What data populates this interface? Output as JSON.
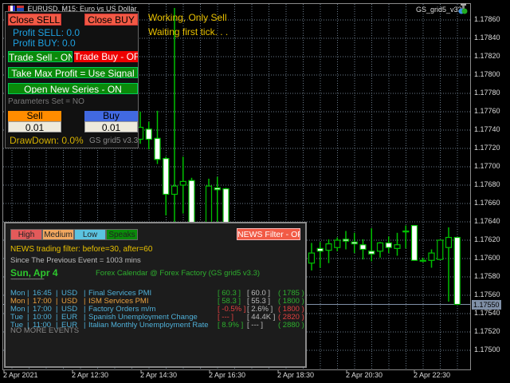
{
  "window": {
    "symbol_title": "EURUSD, M15:  Euro vs US Dollar",
    "ea_label": "GS_grid5_v33"
  },
  "status": {
    "line1": "Working, Only Sell",
    "line2": "Waiting first tick. . ."
  },
  "panel": {
    "close_sell": "Close  SELL",
    "close_buy": "Close  BUY",
    "profit_sell": "Profit SELL: 0.0",
    "profit_buy": "Profit BUY: 0.0",
    "trade_sell": "Trade Sell - ON",
    "trade_buy": "Trade Buy - OFF",
    "take_max_profit": "Take Max Profit = Use Signal",
    "open_new_series": "Open New Series - ON",
    "parameters_set": "Parameters Set = NO",
    "sell_label": "Sell",
    "buy_label": "Buy",
    "sell_lot": "0.01",
    "buy_lot": "0.01",
    "drawdown": "DrawDown: 0.0%",
    "version": "GS grid5 v3.3"
  },
  "news": {
    "impact_buttons": [
      {
        "label": "High",
        "color": "#e35a5a"
      },
      {
        "label": "Medium",
        "color": "#f2a860"
      },
      {
        "label": "Low",
        "color": "#5bc3e0"
      },
      {
        "label": "Speaks",
        "color": "#0a8a0a"
      }
    ],
    "filter_button": "NEWS Filter - OFF",
    "filter_text": "NEWS trading filter: before=30, after=60",
    "since_text": "Since The Previous Event = 1003 mins",
    "date": "Sun, Apr 4",
    "underline": "-------------------------",
    "source": "Forex Calendar @ Forex Factory     (GS grid5 v3.3)",
    "events": [
      {
        "day": "Mon",
        "time": "16:45",
        "cur": "USD",
        "title": "Final Services PMI",
        "actual": "[ 60.3 ]",
        "forecast": "[ 60.0 ]",
        "mins": "( 1785 )",
        "color": "#4fb0d8",
        "actual_color": "#2eae2e",
        "mins_color": "#2eae2e"
      },
      {
        "day": "Mon",
        "time": "17:00",
        "cur": "USD",
        "title": "ISM Services PMI",
        "actual": "[ 58.3 ]",
        "forecast": "[ 55.3 ]",
        "mins": "( 1800 )",
        "color": "#e8a040",
        "actual_color": "#2eae2e",
        "mins_color": "#2eae2e"
      },
      {
        "day": "Mon",
        "time": "17:00",
        "cur": "USD",
        "title": "Factory Orders m/m",
        "actual": "[ -0.5% ]",
        "forecast": "[ 2.6% ]",
        "mins": "( 1800 )",
        "color": "#4fb0d8",
        "actual_color": "#e04040",
        "mins_color": "#e04040"
      },
      {
        "day": "Tue",
        "time": "10:00",
        "cur": "EUR",
        "title": "Spanish Unemployment Change",
        "actual": "[ --- ]",
        "forecast": "[ 44.4K ]",
        "mins": "( 2820 )",
        "color": "#4fb0d8",
        "actual_color": "#e04040",
        "mins_color": "#e04040"
      },
      {
        "day": "Tue",
        "time": "11:00",
        "cur": "EUR",
        "title": "Italian Monthly Unemployment Rate",
        "actual": "[ 8.9% ]",
        "forecast": "[ --- ]",
        "mins": "( 2880 )",
        "color": "#4fb0d8",
        "actual_color": "#2eae2e",
        "mins_color": "#2eae2e"
      }
    ],
    "no_more": "NO MORE EVENTS"
  },
  "chart_data": {
    "type": "candlestick",
    "price_axis": [
      "1.17860",
      "1.17840",
      "1.17820",
      "1.17800",
      "1.17780",
      "1.17760",
      "1.17740",
      "1.17720",
      "1.17700",
      "1.17680",
      "1.17660",
      "1.17640",
      "1.17620",
      "1.17600",
      "1.17580",
      "1.17560",
      "1.17540",
      "1.17520",
      "1.17500"
    ],
    "ylim": [
      1.17495,
      1.17875
    ],
    "current_price": "1.17550",
    "time_axis": [
      "2 Apr 2021",
      "2 Apr 12:30",
      "2 Apr 14:30",
      "2 Apr 16:30",
      "2 Apr 18:30",
      "2 Apr 20:30",
      "2 Apr 22:30"
    ],
    "bull_color": "#00c000",
    "bear_color": "#ffffff",
    "candles": [
      [
        1.1773,
        1.1776,
        1.17725,
        1.17743
      ],
      [
        1.17741,
        1.17749,
        1.17719,
        1.1773
      ],
      [
        1.17731,
        1.17761,
        1.17703,
        1.17708
      ],
      [
        1.17709,
        1.17711,
        1.17647,
        1.1767
      ],
      [
        1.1767,
        1.17873,
        1.17634,
        1.17679
      ],
      [
        1.1768,
        1.17711,
        1.17649,
        1.17684
      ],
      [
        1.17685,
        1.17688,
        1.1762,
        1.1763
      ],
      [
        1.17625,
        1.1763,
        1.176,
        1.17615
      ],
      [
        1.1763,
        1.17687,
        1.1762,
        1.17679
      ],
      [
        1.17677,
        1.17689,
        1.1762,
        1.17675
      ],
      [
        1.17676,
        1.17677,
        1.1761,
        1.1762
      ],
      [
        1.1762,
        1.17628,
        1.176,
        1.17605
      ],
      [
        1.17605,
        1.17615,
        1.17595,
        1.1761
      ],
      [
        1.1761,
        1.17618,
        1.17598,
        1.176
      ],
      [
        1.176,
        1.1761,
        1.1759,
        1.17606
      ],
      [
        1.17606,
        1.17612,
        1.17596,
        1.17598
      ],
      [
        1.17598,
        1.17608,
        1.1759,
        1.17604
      ],
      [
        1.17604,
        1.1761,
        1.17594,
        1.17596
      ],
      [
        1.17596,
        1.17606,
        1.1759,
        1.176
      ],
      [
        1.176,
        1.17604,
        1.17588,
        1.17595
      ],
      [
        1.17595,
        1.17617,
        1.17587,
        1.17606
      ],
      [
        1.17611,
        1.17618,
        1.1759,
        1.17608
      ],
      [
        1.17609,
        1.17621,
        1.17595,
        1.17616
      ],
      [
        1.17612,
        1.17623,
        1.17608,
        1.1762
      ],
      [
        1.17621,
        1.1763,
        1.1761,
        1.17619
      ],
      [
        1.17618,
        1.17628,
        1.17606,
        1.17616
      ],
      [
        1.17615,
        1.17621,
        1.17599,
        1.1761
      ],
      [
        1.17608,
        1.17633,
        1.17597,
        1.17605
      ],
      [
        1.17608,
        1.17618,
        1.17601,
        1.17617
      ],
      [
        1.17617,
        1.17624,
        1.17606,
        1.17612
      ],
      [
        1.17611,
        1.17628,
        1.17603,
        1.17615
      ],
      [
        1.1763,
        1.17636,
        1.17611,
        1.17629
      ],
      [
        1.17636,
        1.17636,
        1.17598,
        1.17598
      ],
      [
        1.17598,
        1.17601,
        1.17596,
        1.17598
      ],
      [
        1.17598,
        1.1761,
        1.1759,
        1.17606
      ],
      [
        1.17599,
        1.1762,
        1.17599,
        1.1762
      ],
      [
        1.17612,
        1.17634,
        1.17553,
        1.17623
      ],
      [
        1.17623,
        1.17623,
        1.1755,
        1.1755
      ]
    ]
  }
}
